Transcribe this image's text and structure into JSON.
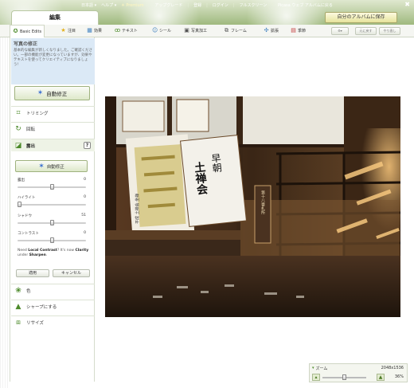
{
  "topbar": {
    "edit_tab": "編集",
    "nav": [
      "日本語",
      "ヘルプ",
      "Premium",
      "アップグレード",
      "登録",
      "ログイン",
      "フルスクリーン",
      "Picasa ウェブ アルバムに戻る"
    ],
    "close": "✖",
    "save_button": "自分のアルバムに保存"
  },
  "toolbar": {
    "tabs": [
      {
        "label": "Basic Edits",
        "icon": "basic-edits-icon",
        "active": true
      },
      {
        "label": "注目",
        "icon": "star-icon"
      },
      {
        "label": "効果",
        "icon": "effects-icon"
      },
      {
        "label": "テキスト",
        "icon": "text-icon"
      },
      {
        "label": "シール",
        "icon": "sticker-icon"
      },
      {
        "label": "写真加工",
        "icon": "touch-up-icon"
      },
      {
        "label": "フレーム",
        "icon": "frame-icon"
      },
      {
        "label": "拡張",
        "icon": "advanced-icon"
      },
      {
        "label": "季節",
        "icon": "seasonal-icon"
      }
    ],
    "gear_label": "▾",
    "undo_label": "元に戻す",
    "redo_label": "やり直し"
  },
  "sidebar": {
    "info_title": "写真の修正",
    "info_text": "基本的な編集が新しくなりました。ご確認ください。一部の機能が変更になっていますが、効果やテキストを使ってクリエイティブになりましょう!",
    "auto_fix_label": "自動修正",
    "sections": {
      "crop": "トリミング",
      "rotate": "回転",
      "exposure": "露出",
      "colors": "色",
      "sharpen": "シャープにする",
      "resize": "リサイズ"
    },
    "help_label": "?",
    "exposure_panel": {
      "auto_fix_label": "自動修正",
      "sliders": [
        {
          "label": "露出",
          "value": "0",
          "fraction": 0.5
        },
        {
          "label": "ハイライト",
          "value": "0",
          "fraction": 0.0
        },
        {
          "label": "シャドウ",
          "value": "51",
          "fraction": 0.51
        },
        {
          "label": "コントラスト",
          "value": "0",
          "fraction": 0.5
        }
      ],
      "hint_pre": "Need ",
      "hint_b1": "Local Contrast",
      "hint_mid": "? It's now ",
      "hint_b2": "Clarity",
      "hint_mid2": " under ",
      "hint_b3": "Sharpen",
      "hint_post": ".",
      "apply_label": "適用",
      "cancel_label": "キャンセル"
    }
  },
  "zoom": {
    "label": "ズーム",
    "dimensions": "2048x1536",
    "percent": "36%",
    "fraction": 0.5
  },
  "photo": {
    "sign_left": "平成 土禅会 坐禅",
    "sign_main_1": "早朝",
    "sign_main_2": "土禅会",
    "sign_post": "第十八番札所"
  }
}
